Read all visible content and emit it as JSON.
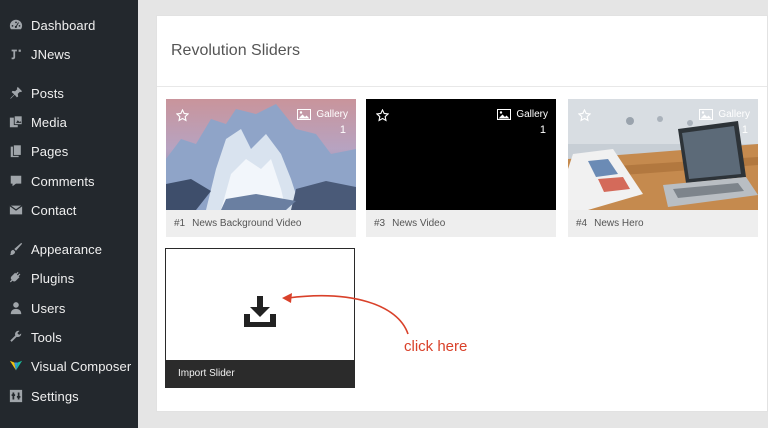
{
  "sidebar": {
    "items": [
      {
        "label": "Dashboard",
        "icon": "dashboard-icon"
      },
      {
        "label": "JNews",
        "icon": "jnews-icon"
      },
      {
        "label": "Posts",
        "icon": "pin-icon"
      },
      {
        "label": "Media",
        "icon": "media-icon"
      },
      {
        "label": "Pages",
        "icon": "pages-icon"
      },
      {
        "label": "Comments",
        "icon": "comment-icon"
      },
      {
        "label": "Contact",
        "icon": "envelope-icon"
      },
      {
        "label": "Appearance",
        "icon": "brush-icon"
      },
      {
        "label": "Plugins",
        "icon": "plug-icon"
      },
      {
        "label": "Users",
        "icon": "user-icon"
      },
      {
        "label": "Tools",
        "icon": "wrench-icon"
      },
      {
        "label": "Visual Composer",
        "icon": "visual-composer-icon"
      },
      {
        "label": "Settings",
        "icon": "settings-icon"
      }
    ]
  },
  "main": {
    "title": "Revolution Sliders",
    "sliders": [
      {
        "number": "#1",
        "name": "News Background Video",
        "type": "Gallery",
        "count": "1"
      },
      {
        "number": "#3",
        "name": "News Video",
        "type": "Gallery",
        "count": "1"
      },
      {
        "number": "#4",
        "name": "News Hero",
        "type": "Gallery",
        "count": "1"
      }
    ],
    "import": {
      "label": "Import Slider"
    }
  },
  "annotation": {
    "text": "click here",
    "color": "#d9412a"
  },
  "colors": {
    "sidebar_bg": "#23282d",
    "page_bg": "#e5e5e5",
    "card_footer_bg": "#eeeeee",
    "import_footer_bg": "#2b2b2b"
  }
}
